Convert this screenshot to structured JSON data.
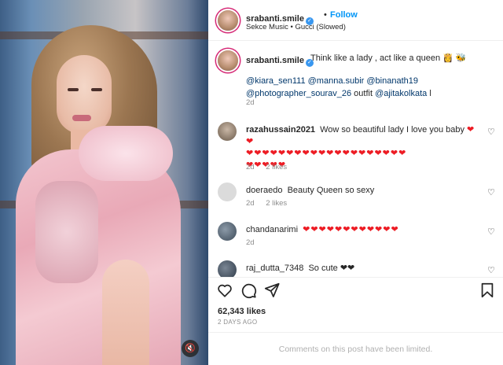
{
  "post": {
    "username": "srabanti.smile",
    "verified_badge": "✓",
    "dot": "•",
    "follow_label": "Follow",
    "audio": "Sekce Music • Gucci (Slowed)",
    "mute_icon": "🔇"
  },
  "caption": {
    "username": "srabanti.smile",
    "text": "Think like a lady , act like a queen 👸 🐝",
    "mentions_line1": "@kiara_sen111 @manna.subir @binanath19",
    "mentions_line2a": "@photographer_sourav_26",
    "mentions_line2b": " outfit ",
    "mentions_line2c": "@ajitakolkata",
    "mentions_line2d": " l",
    "time": "2d"
  },
  "comments": [
    {
      "username": "razahussain2021",
      "text": "Wow so beautiful lady I love you baby",
      "hearts_inline": "❤❤",
      "hearts_line2": "❤❤❤❤❤❤❤❤❤❤❤❤❤❤❤❤❤❤❤❤",
      "hearts_line3": "❤❤❤❤❤",
      "time": "2d",
      "likes": "2 likes"
    },
    {
      "username": "doeraedo",
      "text": "Beauty Queen so sexy",
      "time": "2d",
      "likes": "2 likes"
    },
    {
      "username": "chandanarimi",
      "hearts": "❤❤❤❤❤❤❤❤❤❤❤❤",
      "time": "2d",
      "likes": ""
    },
    {
      "username": "raj_dutta_7348",
      "text": "So cute ❤❤"
    }
  ],
  "actions": {
    "likes": "62,343 likes",
    "date": "2 DAYS AGO"
  },
  "footer": {
    "limited": "Comments on this post have been limited."
  },
  "colors": {
    "follow": "#0095f6",
    "heart": "#ed1c24",
    "mention": "#00376b",
    "muted": "#8e8e8e"
  },
  "icons": [
    "heart-icon",
    "comment-icon",
    "share-icon",
    "bookmark-icon",
    "mute-icon",
    "verified-icon"
  ]
}
